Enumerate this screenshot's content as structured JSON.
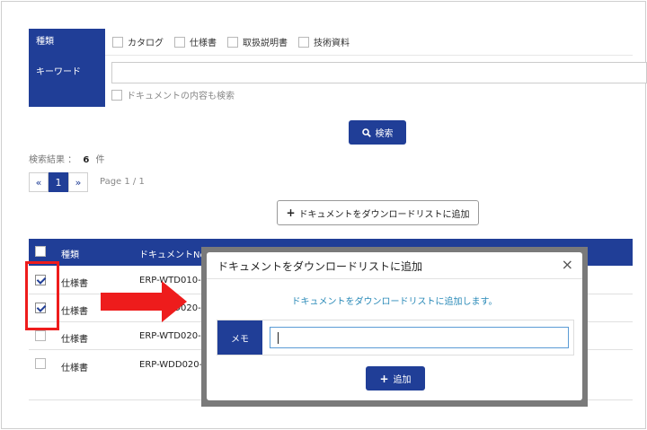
{
  "filters": {
    "type_label": "種類",
    "type_options": [
      "カタログ",
      "仕様書",
      "取扱説明書",
      "技術資料"
    ],
    "keyword_label": "キーワード",
    "keyword_value": "",
    "include_content_label": "ドキュメントの内容も検索"
  },
  "search_button_label": "検索",
  "results": {
    "label": "検索結果 ：",
    "count": "6",
    "unit": "件"
  },
  "pager": {
    "prev": "«",
    "current": "1",
    "next": "»",
    "page_info": "Page 1 / 1"
  },
  "add_to_list_button_label": "ドキュメントをダウンロードリストに追加",
  "table": {
    "headers": {
      "type": "種類",
      "doc_no": "ドキュメントNo"
    },
    "rows": [
      {
        "type": "仕様書",
        "doc_no": "ERP-WTD010-",
        "checked": true
      },
      {
        "type": "仕様書",
        "doc_no": "ERP-WTD020-",
        "checked": true
      },
      {
        "type": "仕様書",
        "doc_no": "ERP-WTD020-",
        "checked": false
      },
      {
        "type": "仕様書",
        "doc_no": "ERP-WDD020-",
        "checked": false
      }
    ]
  },
  "modal": {
    "title": "ドキュメントをダウンロードリストに追加",
    "close": "×",
    "message": "ドキュメントをダウンロードリストに追加します。",
    "memo_label": "メモ",
    "memo_value": "",
    "add_button_label": "追加"
  },
  "colors": {
    "primary": "#203e97",
    "annotation_red": "#ee1c1c",
    "message_text": "#2a8ab8"
  }
}
